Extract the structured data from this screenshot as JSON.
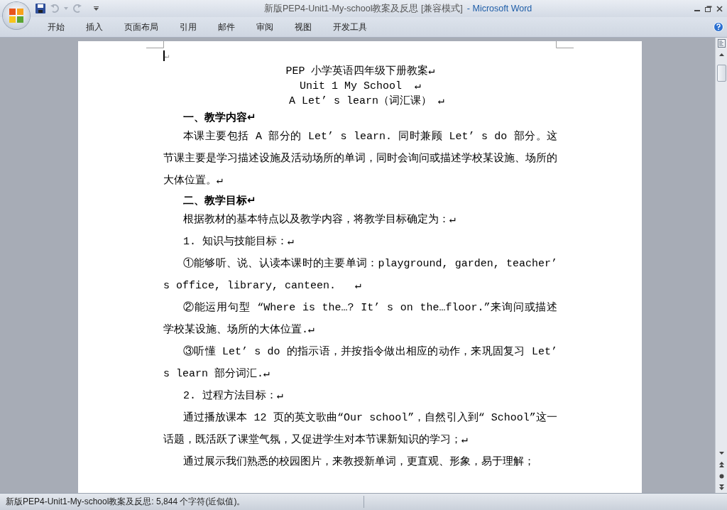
{
  "window": {
    "title": "新版PEP4-Unit1-My-school教案及反思 [兼容模式]",
    "app": "- Microsoft Word"
  },
  "ribbon_tabs": [
    {
      "label": "开始"
    },
    {
      "label": "插入"
    },
    {
      "label": "页面布局"
    },
    {
      "label": "引用"
    },
    {
      "label": "邮件"
    },
    {
      "label": "审阅"
    },
    {
      "label": "视图"
    },
    {
      "label": "开发工具"
    }
  ],
  "document": {
    "paragraphs": [
      {
        "kind": "cursor",
        "text": "↵"
      },
      {
        "kind": "title",
        "text": "PEP 小学英语四年级下册教案↵"
      },
      {
        "kind": "title",
        "text": "Unit 1 My School  ↵"
      },
      {
        "kind": "title",
        "text": "  A Let’ s learn（词汇课） ↵"
      },
      {
        "kind": "heading",
        "text": "一、教学内容↵"
      },
      {
        "kind": "body",
        "text": "本课主要包括 A 部分的 Let’ s learn. 同时兼顾 Let’ s do 部分。这节课主要是学习描述设施及活动场所的单词，同时会询问或描述学校某设施、场所的大体位置。↵"
      },
      {
        "kind": "heading",
        "text": "二、教学目标↵"
      },
      {
        "kind": "body",
        "text": "根据教材的基本特点以及教学内容，将教学目标确定为：↵"
      },
      {
        "kind": "body",
        "text": "1. 知识与技能目标：↵"
      },
      {
        "kind": "body",
        "text": "①能够听、说、认读本课时的主要单词：playground, garden, teacher’ s office, library, canteen.   ↵"
      },
      {
        "kind": "body",
        "text": "②能运用句型 “Where is the…? It’ s on the…floor.”来询问或描述学校某设施、场所的大体位置.↵"
      },
      {
        "kind": "body",
        "text": "③听懂 Let’ s do 的指示语，并按指令做出相应的动作，来巩固复习 Let’ s learn 部分词汇.↵"
      },
      {
        "kind": "body",
        "text": "2. 过程方法目标：↵"
      },
      {
        "kind": "body",
        "text": "通过播放课本 12 页的英文歌曲“Our school”，自然引入到“ School”这一话题，既活跃了课堂气氛，又促进学生对本节课新知识的学习；↵"
      },
      {
        "kind": "body",
        "text": "通过展示我们熟悉的校园图片，来教授新单词，更直观、形象，易于理解；"
      }
    ]
  },
  "status_bar": {
    "text": "新版PEP4-Unit1-My-school教案及反思: 5,844 个字符(近似值)。"
  }
}
